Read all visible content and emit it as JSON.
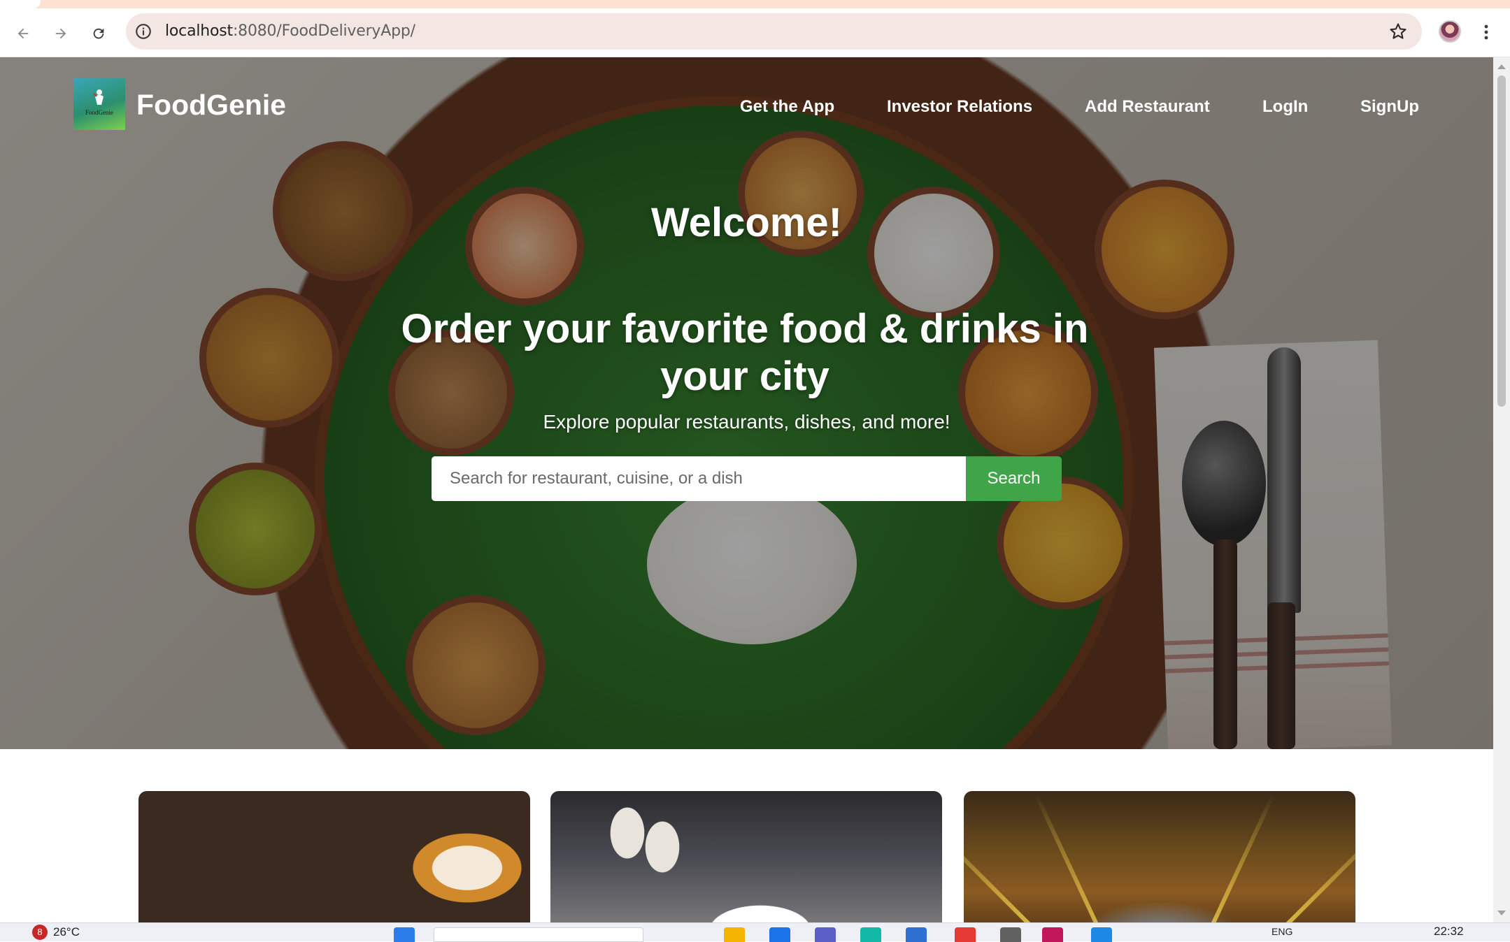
{
  "browser": {
    "url_host": "localhost",
    "url_path": ":8080/FoodDeliveryApp/"
  },
  "site": {
    "brand": "FoodGenie",
    "logo_word": "FoodGenie",
    "nav": [
      "Get the App",
      "Investor Relations",
      "Add Restaurant",
      "LogIn",
      "SignUp"
    ]
  },
  "hero": {
    "welcome": "Welcome!",
    "headline": "Order your favorite food & drinks in your city",
    "subheading": "Explore popular restaurants, dishes, and more!",
    "search_placeholder": "Search for restaurant, cuisine, or a dish",
    "search_button": "Search"
  },
  "cards": [
    {
      "name": "indian-dishes-card",
      "image": "curry-and-naan-photo"
    },
    {
      "name": "fine-dining-card",
      "image": "restaurant-table-photo"
    },
    {
      "name": "nightlife-card",
      "image": "concert-lights-photo"
    }
  ],
  "taskbar": {
    "weather_badge": "8",
    "temperature": "26°C",
    "language": "ENG",
    "time": "22:32"
  },
  "colors": {
    "search_button": "#3fa548",
    "brand_text": "#ffffff",
    "tab_strip": "#fde1d1",
    "omnibox": "#f4e7e3"
  }
}
